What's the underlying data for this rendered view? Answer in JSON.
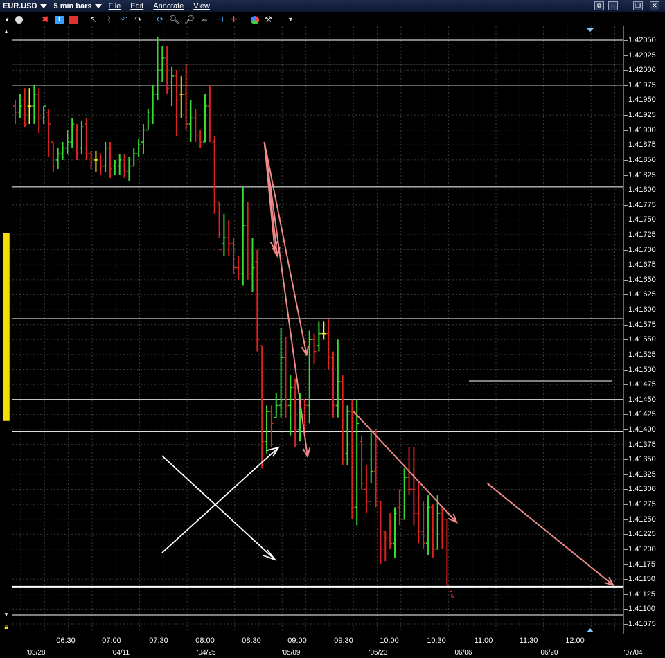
{
  "window": {
    "symbol": "EUR.USD",
    "bar_size": "5 min bars",
    "menus": [
      "File",
      "Edit",
      "Annotate",
      "View"
    ]
  },
  "toolbar": {
    "icons": [
      "crosshair-icon",
      "circle-icon",
      "cross-icon",
      "text-icon",
      "bar-icon",
      "pointer-icon",
      "undo-icon",
      "redo-icon",
      "refresh-icon",
      "zoom-in-icon",
      "zoom-out-icon",
      "fit-icon",
      "scroll-left-icon",
      "studies-icon",
      "tools-icon",
      "dropdown-icon"
    ]
  },
  "colors": {
    "up": "#33dd33",
    "down": "#dd2222",
    "neutral": "#ffee22",
    "annotation": "#f08a8a",
    "white_line": "#ffffff",
    "grid": "#3a3a3a"
  },
  "y_labels": [
    "1.42050",
    "1.42025",
    "1.42000",
    "1.41975",
    "1.41950",
    "1.41925",
    "1.41900",
    "1.41875",
    "1.41850",
    "1.41825",
    "1.41800",
    "1.41775",
    "1.41750",
    "1.41725",
    "1.41700",
    "1.41675",
    "1.41650",
    "1.41625",
    "1.41600",
    "1.41575",
    "1.41550",
    "1.41525",
    "1.41500",
    "1.41475",
    "1.41450",
    "1.41425",
    "1.41400",
    "1.41375",
    "1.41350",
    "1.41325",
    "1.41300",
    "1.41275",
    "1.41250",
    "1.41225",
    "1.41200",
    "1.41175",
    "1.41150",
    "1.41125",
    "1.41100",
    "1.41075"
  ],
  "x_labels": [
    "06:30",
    "07:00",
    "07:30",
    "08:00",
    "08:30",
    "09:00",
    "09:30",
    "10:00",
    "10:30",
    "11:00",
    "11:30",
    "12:00"
  ],
  "date_labels": [
    "'03/28",
    "'04/11",
    "'04/25",
    "'05/09",
    "'05/23",
    "'06/06",
    "'06/20",
    "'07/04"
  ],
  "chart_data": {
    "type": "ohlc",
    "y_range": [
      1.41065,
      1.42065
    ],
    "horizontal_lines": [
      1.4205,
      1.4201,
      1.41975,
      1.41805,
      1.41585,
      1.4145,
      1.41397,
      1.41137,
      1.4109
    ],
    "bars": [
      [
        1.4194,
        1.4195,
        1.4191,
        1.4193
      ],
      [
        1.4193,
        1.4196,
        1.4192,
        1.4194
      ],
      [
        1.4195,
        1.4197,
        1.41905,
        1.4191
      ],
      [
        1.4194,
        1.4197,
        1.4191,
        1.4194
      ],
      [
        1.4194,
        1.41975,
        1.4191,
        1.4196
      ],
      [
        1.4196,
        1.4197,
        1.41895,
        1.4192
      ],
      [
        1.4192,
        1.4194,
        1.4191,
        1.4194
      ],
      [
        1.4193,
        1.41935,
        1.41855,
        1.4191
      ],
      [
        1.4188,
        1.4188,
        1.4183,
        1.4184
      ],
      [
        1.4185,
        1.4187,
        1.41835,
        1.4186
      ],
      [
        1.4186,
        1.4188,
        1.4185,
        1.4187
      ],
      [
        1.4187,
        1.419,
        1.4186,
        1.4188
      ],
      [
        1.4188,
        1.4192,
        1.4187,
        1.4191
      ],
      [
        1.419,
        1.4191,
        1.4185,
        1.4186
      ],
      [
        1.4187,
        1.41915,
        1.4186,
        1.41905
      ],
      [
        1.4191,
        1.4192,
        1.4185,
        1.4186
      ],
      [
        1.4186,
        1.41865,
        1.41835,
        1.41855
      ],
      [
        1.4185,
        1.41865,
        1.4183,
        1.4185
      ],
      [
        1.4186,
        1.4186,
        1.41825,
        1.4184
      ],
      [
        1.4184,
        1.4188,
        1.4183,
        1.4187
      ],
      [
        1.4187,
        1.4188,
        1.4182,
        1.41835
      ],
      [
        1.4184,
        1.4185,
        1.41825,
        1.41845
      ],
      [
        1.4184,
        1.4186,
        1.41825,
        1.4185
      ],
      [
        1.4184,
        1.4186,
        1.4182,
        1.4183
      ],
      [
        1.4183,
        1.41855,
        1.41815,
        1.4184
      ],
      [
        1.4184,
        1.4187,
        1.4184,
        1.4186
      ],
      [
        1.4186,
        1.41885,
        1.41855,
        1.41875
      ],
      [
        1.4188,
        1.4191,
        1.4186,
        1.419
      ],
      [
        1.419,
        1.41935,
        1.419,
        1.4193
      ],
      [
        1.4192,
        1.41975,
        1.4191,
        1.4196
      ],
      [
        1.4196,
        1.42055,
        1.4195,
        1.42
      ],
      [
        1.42,
        1.4204,
        1.4198,
        1.4202
      ],
      [
        1.4202,
        1.4204,
        1.4196,
        1.4197
      ],
      [
        1.4198,
        1.42005,
        1.4194,
        1.4199
      ],
      [
        1.4199,
        1.42,
        1.4189,
        1.4195
      ],
      [
        1.4196,
        1.4199,
        1.4192,
        1.4196
      ],
      [
        1.4196,
        1.4201,
        1.419,
        1.4191
      ],
      [
        1.4191,
        1.4195,
        1.4188,
        1.4192
      ],
      [
        1.4192,
        1.41935,
        1.4188,
        1.4189
      ],
      [
        1.4189,
        1.419,
        1.4187,
        1.4188
      ],
      [
        1.4188,
        1.4196,
        1.4188,
        1.4194
      ],
      [
        1.4194,
        1.41975,
        1.4188,
        1.419
      ],
      [
        1.4188,
        1.4189,
        1.4176,
        1.4178
      ],
      [
        1.4178,
        1.4178,
        1.4172,
        1.417
      ],
      [
        1.4171,
        1.4176,
        1.4169,
        1.4172
      ],
      [
        1.4172,
        1.4175,
        1.4169,
        1.4171
      ],
      [
        1.4171,
        1.4172,
        1.4166,
        1.4167
      ],
      [
        1.4167,
        1.4169,
        1.4165,
        1.4166
      ],
      [
        1.4166,
        1.41805,
        1.4164,
        1.4174
      ],
      [
        1.4174,
        1.4178,
        1.4165,
        1.4166
      ],
      [
        1.4166,
        1.4172,
        1.4163,
        1.4167
      ],
      [
        1.4168,
        1.417,
        1.4153,
        1.4155
      ],
      [
        1.4154,
        1.4154,
        1.41335,
        1.4138
      ],
      [
        1.4138,
        1.4144,
        1.4136,
        1.4143
      ],
      [
        1.4143,
        1.4144,
        1.4137,
        1.4141
      ],
      [
        1.4142,
        1.4146,
        1.4142,
        1.4144
      ],
      [
        1.4144,
        1.4157,
        1.4142,
        1.4152
      ],
      [
        1.4152,
        1.41555,
        1.4142,
        1.4144
      ],
      [
        1.4144,
        1.4149,
        1.4139,
        1.4147
      ],
      [
        1.4147,
        1.41485,
        1.4137,
        1.414
      ],
      [
        1.414,
        1.4146,
        1.4138,
        1.4145
      ],
      [
        1.4145,
        1.4145,
        1.4139,
        1.4144
      ],
      [
        1.4144,
        1.41565,
        1.4141,
        1.4155
      ],
      [
        1.4155,
        1.4156,
        1.4151,
        1.4153
      ],
      [
        1.4154,
        1.4158,
        1.4153,
        1.4156
      ],
      [
        1.4156,
        1.4158,
        1.4155,
        1.4156
      ],
      [
        1.4156,
        1.41585,
        1.415,
        1.4152
      ],
      [
        1.4152,
        1.4153,
        1.4142,
        1.4144
      ],
      [
        1.4144,
        1.4155,
        1.4142,
        1.4148
      ],
      [
        1.4148,
        1.4149,
        1.4134,
        1.4135
      ],
      [
        1.4136,
        1.4144,
        1.4134,
        1.4143
      ],
      [
        1.4143,
        1.4145,
        1.4125,
        1.4127
      ],
      [
        1.4127,
        1.4145,
        1.4124,
        1.4141
      ],
      [
        1.4138,
        1.4139,
        1.413,
        1.4131
      ],
      [
        1.413,
        1.4134,
        1.4126,
        1.4128
      ],
      [
        1.4128,
        1.41395,
        1.4131,
        1.4133
      ],
      [
        1.4133,
        1.414,
        1.4127,
        1.4128
      ],
      [
        1.4128,
        1.4128,
        1.41175,
        1.412
      ],
      [
        1.4123,
        1.4123,
        1.4118,
        1.4122
      ],
      [
        1.4122,
        1.4126,
        1.412,
        1.4121
      ],
      [
        1.4121,
        1.4127,
        1.41185,
        1.4126
      ],
      [
        1.4127,
        1.413,
        1.4124,
        1.4125
      ],
      [
        1.4125,
        1.41335,
        1.4125,
        1.4132
      ],
      [
        1.4132,
        1.4137,
        1.4129,
        1.413
      ],
      [
        1.413,
        1.4137,
        1.4124,
        1.4126
      ],
      [
        1.4126,
        1.4131,
        1.4121,
        1.4123
      ],
      [
        1.4123,
        1.4128,
        1.412,
        1.4121
      ],
      [
        1.4121,
        1.4129,
        1.4119,
        1.4127
      ],
      [
        1.4127,
        1.41275,
        1.41185,
        1.412
      ],
      [
        1.412,
        1.4129,
        1.412,
        1.4126
      ],
      [
        1.4126,
        1.4127,
        1.412,
        1.4125
      ],
      [
        1.4125,
        1.4125,
        1.4114,
        1.4114
      ],
      [
        1.4113,
        1.41125,
        1.4112,
        1.4112
      ]
    ],
    "annotations": [
      {
        "type": "arrow",
        "from": [
          76.5,
          1.4188
        ],
        "to": [
          78.7,
          1.417
        ]
      },
      {
        "type": "arrow",
        "from": [
          76.5,
          1.4188
        ],
        "to": [
          79.2,
          1.4169
        ]
      },
      {
        "type": "arrow",
        "from": [
          76.5,
          1.4188
        ],
        "to": [
          85.4,
          1.41525
        ]
      },
      {
        "type": "arrow",
        "from": [
          76.5,
          1.4188
        ],
        "to": [
          85.6,
          1.41355
        ]
      },
      {
        "type": "arrow",
        "from": [
          95.3,
          1.4143
        ],
        "to": [
          117,
          1.41245
        ]
      },
      {
        "type": "arrow",
        "from": [
          123.5,
          1.4131
        ],
        "to": [
          150,
          1.4114
        ]
      }
    ]
  }
}
